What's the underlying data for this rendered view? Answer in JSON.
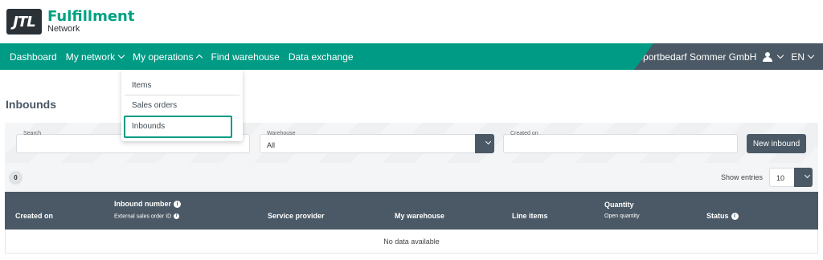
{
  "brand": {
    "logo_text": "JTL",
    "title": "Fulfillment",
    "subtitle": "Network"
  },
  "nav": {
    "items": [
      {
        "label": "Dashboard"
      },
      {
        "label": "My network"
      },
      {
        "label": "My operations"
      },
      {
        "label": "Find warehouse"
      },
      {
        "label": "Data exchange"
      }
    ],
    "company": "Sportbedarf Sommer GmbH",
    "language": "EN"
  },
  "dropdown": {
    "items": [
      "Items",
      "Sales orders",
      "Inbounds"
    ],
    "active": "Inbounds"
  },
  "page": {
    "title": "Inbounds"
  },
  "filters": {
    "search_label": "Search",
    "search_value": "",
    "warehouse_label": "Warehouse",
    "warehouse_value": "All",
    "created_label": "Created on",
    "created_value": "",
    "new_button": "New inbound"
  },
  "listing": {
    "count": "0",
    "show_entries_label": "Show entries",
    "entries_value": "10"
  },
  "table": {
    "columns": {
      "created_on": "Created on",
      "inbound_number": "Inbound number",
      "external_id": "External sales order ID",
      "service_provider": "Service provider",
      "my_warehouse": "My warehouse",
      "line_items": "Line items",
      "quantity": "Quantity",
      "open_quantity": "Open quantity",
      "status": "Status"
    },
    "empty_text": "No data available"
  },
  "colors": {
    "brand_green": "#009b85",
    "dark_slate": "#4b5966"
  }
}
